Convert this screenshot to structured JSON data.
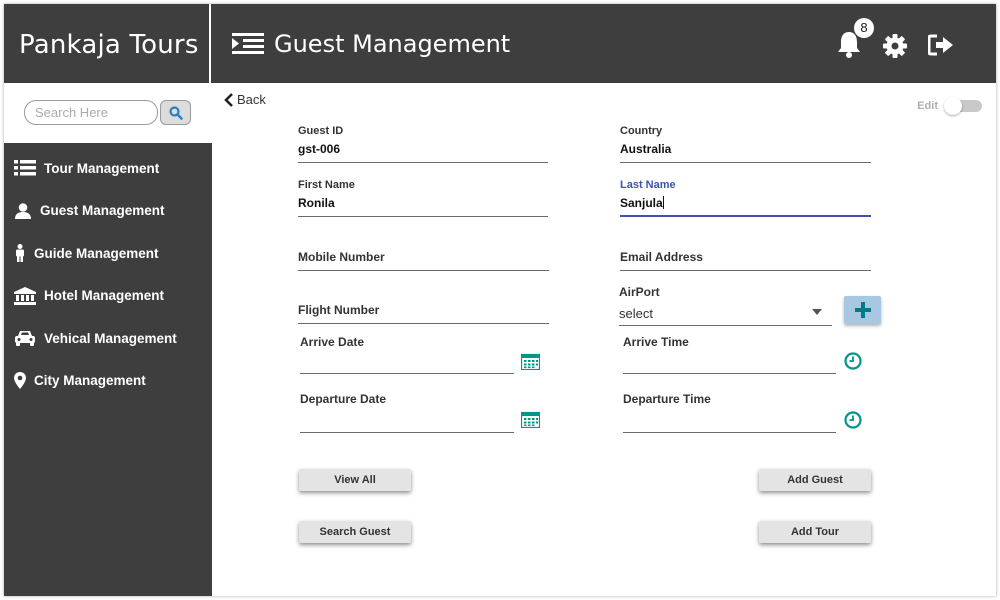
{
  "app": {
    "name": "Pankaja Tours"
  },
  "header": {
    "title": "Guest Management",
    "notification_count": "8"
  },
  "sidebar": {
    "search_placeholder": "Search Here",
    "items": [
      {
        "label": "Tour Management",
        "icon": "list-icon"
      },
      {
        "label": "Guest Management",
        "icon": "user-icon"
      },
      {
        "label": "Guide Management",
        "icon": "person-icon"
      },
      {
        "label": "Hotel Management",
        "icon": "bank-icon"
      },
      {
        "label": "Vehical Management",
        "icon": "car-icon"
      },
      {
        "label": "City Management",
        "icon": "map-marker-icon"
      }
    ]
  },
  "main": {
    "back_label": "Back",
    "edit_label": "Edit",
    "fields": {
      "guest_id": {
        "label": "Guest ID",
        "value": "gst-006"
      },
      "country": {
        "label": "Country",
        "value": "Australia"
      },
      "first_name": {
        "label": "First Name",
        "value": "Ronila"
      },
      "last_name": {
        "label": "Last Name",
        "value": "Sanjula"
      },
      "mobile": {
        "label": "Mobile Number"
      },
      "email": {
        "label": "Email Address"
      },
      "flight": {
        "label": "Flight Number"
      },
      "airport": {
        "label": "AirPort",
        "value": "select"
      },
      "arrive_date": {
        "label": "Arrive Date"
      },
      "arrive_time": {
        "label": "Arrive Time"
      },
      "departure_date": {
        "label": "Departure Date"
      },
      "departure_time": {
        "label": "Departure Time"
      }
    },
    "buttons": {
      "view_all": "View All",
      "add_guest": "Add Guest",
      "search_guest": "Search Guest",
      "add_tour": "Add Tour"
    }
  },
  "colors": {
    "sidebar_bg": "#3e3e3e",
    "accent": "#3f51b5",
    "icon_teal": "#009688"
  }
}
